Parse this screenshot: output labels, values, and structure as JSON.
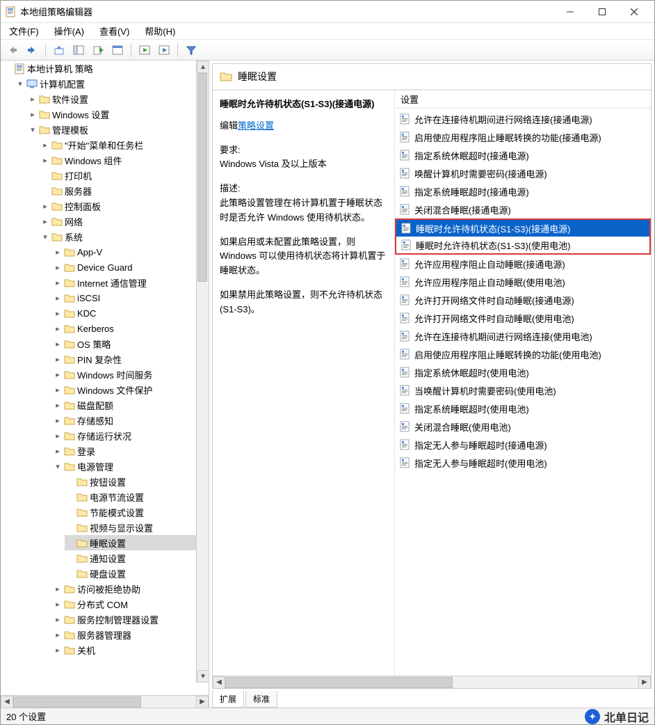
{
  "window": {
    "title": "本地组策略编辑器"
  },
  "menubar": [
    "文件(F)",
    "操作(A)",
    "查看(V)",
    "帮助(H)"
  ],
  "tree": {
    "root": "本地计算机 策略",
    "computer_config": "计算机配置",
    "software_settings": "软件设置",
    "windows_settings": "Windows 设置",
    "admin_templates": "管理模板",
    "start_taskbar": "\"开始\"菜单和任务栏",
    "windows_components": "Windows 组件",
    "printers": "打印机",
    "servers": "服务器",
    "control_panel": "控制面板",
    "network": "网络",
    "system": "系统",
    "system_children": [
      "App-V",
      "Device Guard",
      "Internet 通信管理",
      "iSCSI",
      "KDC",
      "Kerberos",
      "OS 策略",
      "PIN 复杂性",
      "Windows 时间服务",
      "Windows 文件保护",
      "磁盘配额",
      "存储感知",
      "存储运行状况",
      "登录"
    ],
    "power_mgmt": "电源管理",
    "power_children": [
      "按钮设置",
      "电源节流设置",
      "节能模式设置",
      "视频与显示设置",
      "睡眠设置",
      "通知设置",
      "硬盘设置"
    ],
    "selected_child": "睡眠设置",
    "after_power": [
      "访问被拒绝协助",
      "分布式 COM",
      "服务控制管理器设置",
      "服务器管理器",
      "关机"
    ]
  },
  "right": {
    "header": "睡眠设置",
    "selected_title": "睡眠时允许待机状态(S1-S3)(接通电源)",
    "edit_label": "编辑",
    "edit_link": "策略设置",
    "req_label": "要求:",
    "req_text": "Windows Vista 及以上版本",
    "desc_label": "描述:",
    "desc_p1": "此策略设置管理在将计算机置于睡眠状态时是否允许 Windows 使用待机状态。",
    "desc_p2": "如果启用或未配置此策略设置，则 Windows 可以使用待机状态将计算机置于睡眠状态。",
    "desc_p3": "如果禁用此策略设置，则不允许待机状态(S1-S3)。",
    "list_header": "设置",
    "items": [
      "允许在连接待机期间进行网络连接(接通电源)",
      "启用使应用程序阻止睡眠转换的功能(接通电源)",
      "指定系统休眠超时(接通电源)",
      "唤醒计算机时需要密码(接通电源)",
      "指定系统睡眠超时(接通电源)",
      "关闭混合睡眠(接通电源)",
      "睡眠时允许待机状态(S1-S3)(接通电源)",
      "睡眠时允许待机状态(S1-S3)(使用电池)",
      "允许应用程序阻止自动睡眠(接通电源)",
      "允许应用程序阻止自动睡眠(使用电池)",
      "允许打开网络文件时自动睡眠(接通电源)",
      "允许打开网络文件时自动睡眠(使用电池)",
      "允许在连接待机期间进行网络连接(使用电池)",
      "启用使应用程序阻止睡眠转换的功能(使用电池)",
      "指定系统休眠超时(使用电池)",
      "当唤醒计算机时需要密码(使用电池)",
      "指定系统睡眠超时(使用电池)",
      "关闭混合睡眠(使用电池)",
      "指定无人参与睡眠超时(接通电源)",
      "指定无人参与睡眠超时(使用电池)"
    ],
    "selected_index": 6,
    "highlight_indices": [
      6,
      7
    ]
  },
  "tabs": [
    "扩展",
    "标准"
  ],
  "statusbar": "20 个设置",
  "watermark": "北单日记"
}
